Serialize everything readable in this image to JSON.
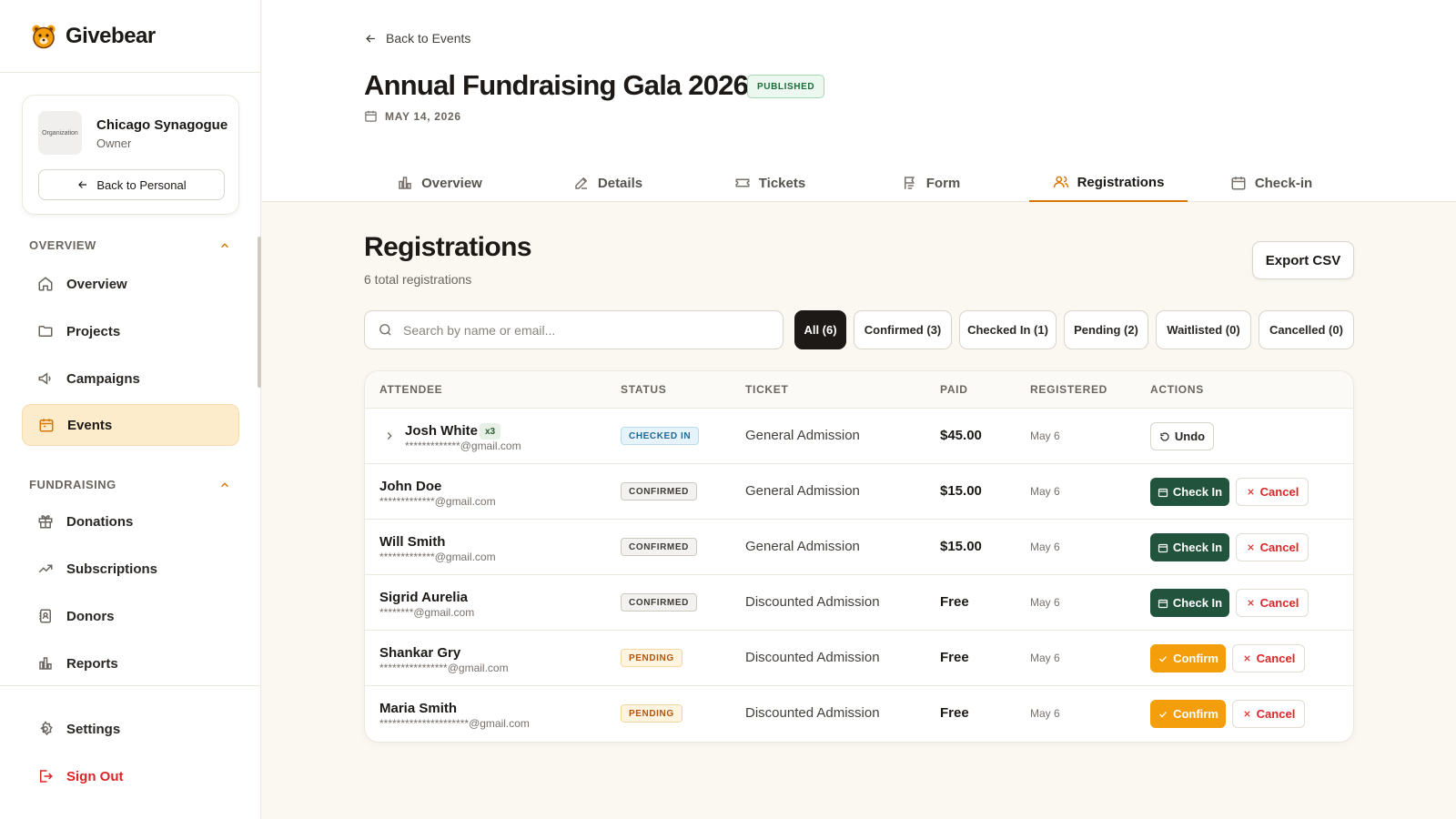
{
  "brand": {
    "name": "Givebear"
  },
  "org": {
    "logo_text": "Organization",
    "name": "Chicago Synagogue",
    "role": "Owner",
    "back_label": "Back to Personal"
  },
  "sidebar": {
    "overview_heading": "OVERVIEW",
    "overview_items": [
      {
        "label": "Overview",
        "icon": "home-icon"
      },
      {
        "label": "Projects",
        "icon": "folder-icon"
      },
      {
        "label": "Campaigns",
        "icon": "megaphone-icon"
      },
      {
        "label": "Events",
        "icon": "calendar-icon",
        "active": true
      }
    ],
    "fundraising_heading": "FUNDRAISING",
    "fundraising_items": [
      {
        "label": "Donations",
        "icon": "gift-icon"
      },
      {
        "label": "Subscriptions",
        "icon": "trending-icon"
      },
      {
        "label": "Donors",
        "icon": "contacts-icon"
      },
      {
        "label": "Reports",
        "icon": "bar-chart-icon"
      }
    ],
    "settings_label": "Settings",
    "signout_label": "Sign Out"
  },
  "header": {
    "back_label": "Back to Events",
    "title": "Annual Fundraising Gala 2026",
    "status_badge": "PUBLISHED",
    "date": "MAY 14, 2026"
  },
  "tabs": [
    {
      "label": "Overview",
      "icon": "bar-chart-icon"
    },
    {
      "label": "Details",
      "icon": "edit-icon"
    },
    {
      "label": "Tickets",
      "icon": "ticket-icon"
    },
    {
      "label": "Form",
      "icon": "form-icon"
    },
    {
      "label": "Registrations",
      "icon": "users-icon",
      "active": true
    },
    {
      "label": "Check-in",
      "icon": "calendar-check-icon"
    }
  ],
  "registrations": {
    "title": "Registrations",
    "subtitle": "6 total registrations",
    "export_label": "Export CSV",
    "search_placeholder": "Search by name or email...",
    "filters": [
      {
        "label": "All (6)",
        "active": true
      },
      {
        "label": "Confirmed (3)"
      },
      {
        "label": "Checked In (1)"
      },
      {
        "label": "Pending (2)"
      },
      {
        "label": "Waitlisted (0)"
      },
      {
        "label": "Cancelled (0)"
      }
    ],
    "columns": [
      "ATTENDEE",
      "STATUS",
      "TICKET",
      "PAID",
      "REGISTERED",
      "ACTIONS"
    ],
    "rows": [
      {
        "name": "Josh White",
        "qty": "x3",
        "email": "*************@gmail.com",
        "status": "CHECKED IN",
        "ticket": "General Admission",
        "paid": "$45.00",
        "registered": "May 6",
        "actions": [
          "Undo"
        ]
      },
      {
        "name": "John Doe",
        "email": "*************@gmail.com",
        "status": "CONFIRMED",
        "ticket": "General Admission",
        "paid": "$15.00",
        "registered": "May 6",
        "actions": [
          "Check In",
          "Cancel"
        ]
      },
      {
        "name": "Will Smith",
        "email": "*************@gmail.com",
        "status": "CONFIRMED",
        "ticket": "General Admission",
        "paid": "$15.00",
        "registered": "May 6",
        "actions": [
          "Check In",
          "Cancel"
        ]
      },
      {
        "name": "Sigrid Aurelia",
        "email": "********@gmail.com",
        "status": "CONFIRMED",
        "ticket": "Discounted Admission",
        "paid": "Free",
        "registered": "May 6",
        "actions": [
          "Check In",
          "Cancel"
        ]
      },
      {
        "name": "Shankar Gry",
        "email": "****************@gmail.com",
        "status": "PENDING",
        "ticket": "Discounted Admission",
        "paid": "Free",
        "registered": "May 6",
        "actions": [
          "Confirm",
          "Cancel"
        ]
      },
      {
        "name": "Maria Smith",
        "email": "*********************@gmail.com",
        "status": "PENDING",
        "ticket": "Discounted Admission",
        "paid": "Free",
        "registered": "May 6",
        "actions": [
          "Confirm",
          "Cancel"
        ]
      }
    ]
  },
  "colors": {
    "accent": "#d97706",
    "checkin_button": "#22543d",
    "confirm_button": "#f59e0b",
    "danger": "#dc2626"
  }
}
